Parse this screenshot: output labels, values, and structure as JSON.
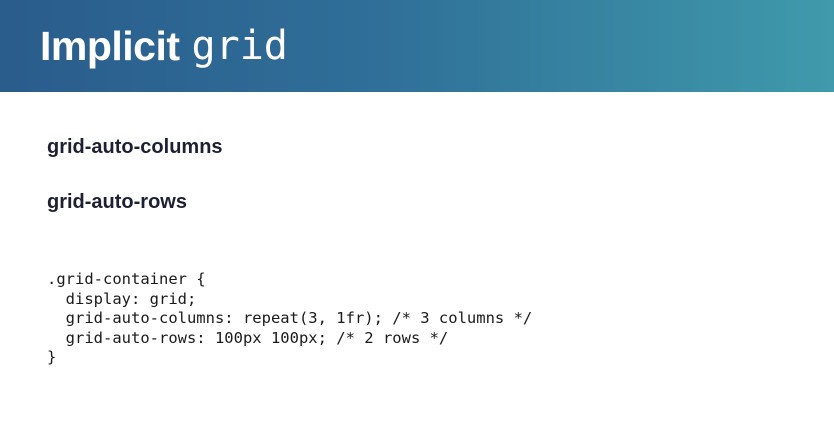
{
  "header": {
    "title_word": "Implicit",
    "title_code": "grid"
  },
  "properties": [
    "grid-auto-columns",
    "grid-auto-rows"
  ],
  "code": {
    "lines": [
      ".grid-container {",
      "  display: grid;",
      "  grid-auto-columns: repeat(3, 1fr); /* 3 columns */",
      "  grid-auto-rows: 100px 100px; /* 2 rows */",
      "}"
    ]
  },
  "colors": {
    "header_gradient_start": "#2a5c8c",
    "header_gradient_end": "#3f9aab",
    "title_text": "#ffffff",
    "body_text": "#1d2033"
  }
}
